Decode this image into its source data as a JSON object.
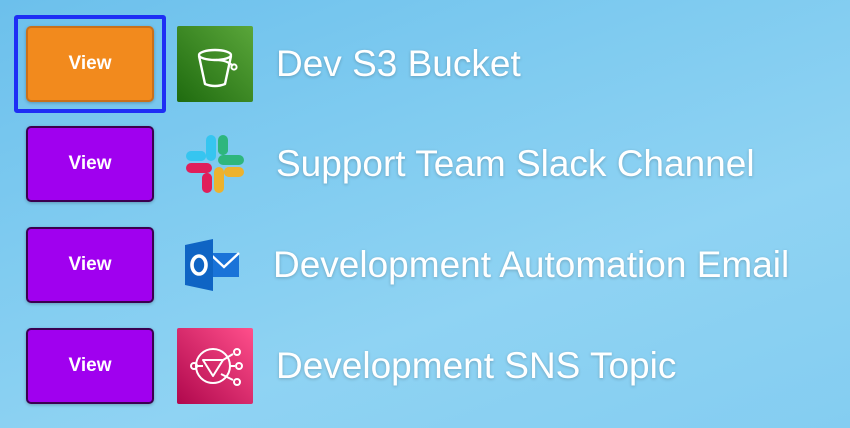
{
  "items": [
    {
      "button_label": "View",
      "label": "Dev S3 Bucket",
      "icon": "s3-bucket-icon",
      "selected": true,
      "icon_color": "#3f8624"
    },
    {
      "button_label": "View",
      "label": "Support Team Slack Channel",
      "icon": "slack-icon",
      "selected": false
    },
    {
      "button_label": "View",
      "label": "Development Automation Email",
      "icon": "outlook-icon",
      "selected": false,
      "icon_color": "#0f64c4"
    },
    {
      "button_label": "View",
      "label": "Development SNS Topic",
      "icon": "sns-topic-icon",
      "selected": false,
      "icon_color": "#d6245c"
    }
  ],
  "colors": {
    "button_default": "#a000ef",
    "button_selected": "#f28a1d",
    "focus_ring": "#1e2ef5"
  }
}
